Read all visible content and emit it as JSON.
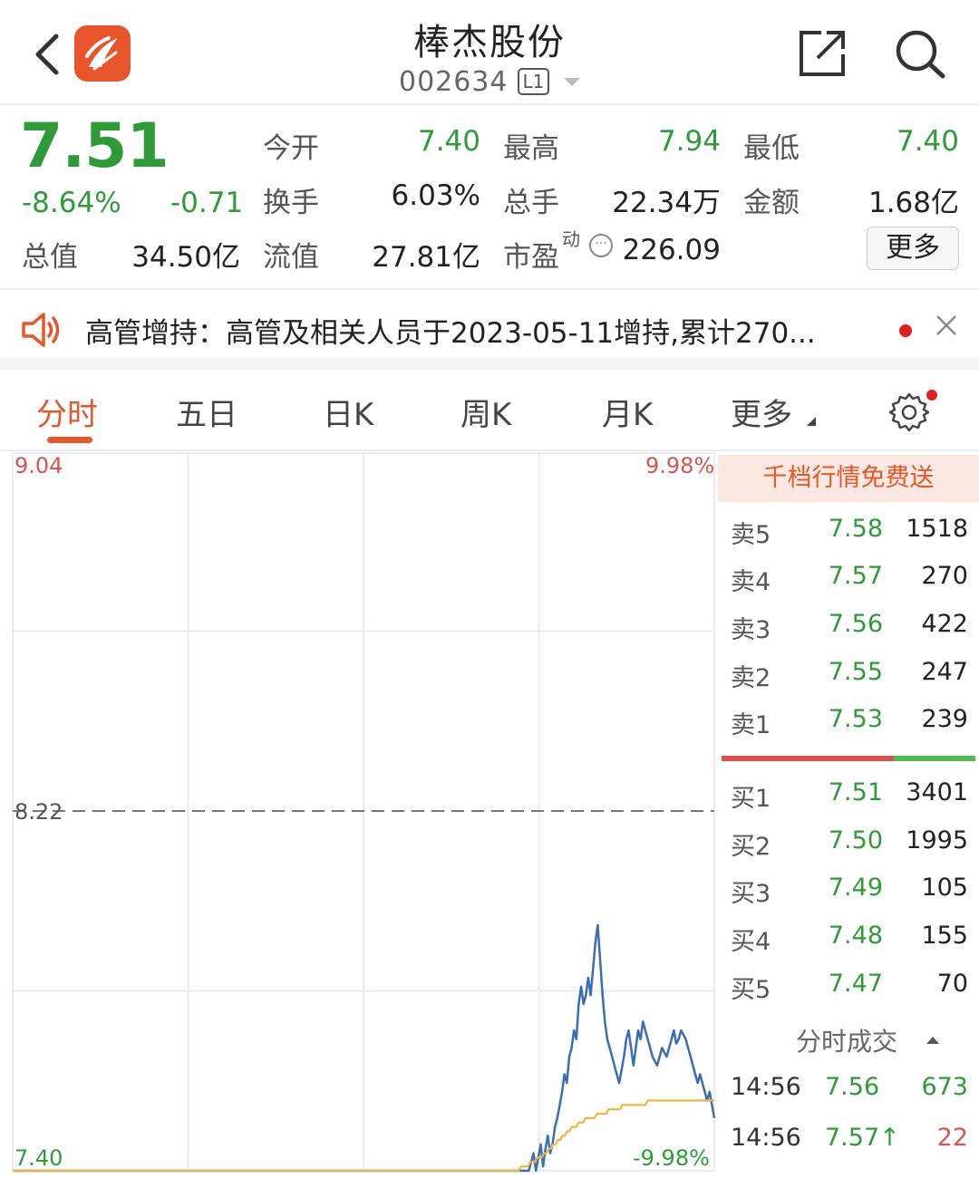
{
  "header": {
    "title": "棒杰股份",
    "code": "002634",
    "level": "L1"
  },
  "quote": {
    "price": "7.51",
    "change_pct": "-8.64%",
    "change": "-0.71",
    "stats": [
      {
        "label": "今开",
        "value": "7.40"
      },
      {
        "label": "最高",
        "value": "7.94"
      },
      {
        "label": "最低",
        "value": "7.40"
      },
      {
        "label": "换手",
        "value": "6.03%"
      },
      {
        "label": "总手",
        "value": "22.34万"
      },
      {
        "label": "金额",
        "value": "1.68亿"
      },
      {
        "label": "总值",
        "value": "34.50亿"
      },
      {
        "label": "流值",
        "value": "27.81亿"
      },
      {
        "label": "市盈",
        "value": "226.09"
      }
    ],
    "pe_superscript": "动",
    "more_label": "更多"
  },
  "notice": {
    "text": "高管增持：高管及相关人员于2023-05-11增持,累计270..."
  },
  "tabs": [
    "分时",
    "五日",
    "日K",
    "周K",
    "月K",
    "更多"
  ],
  "active_tab": "分时",
  "colors": {
    "accent": "#e8552b",
    "up": "#d9534f",
    "down": "#2f9b38",
    "price_line": "#3a6db5",
    "avg_line": "#f0b440"
  },
  "chart_data": {
    "type": "line",
    "y_axis_left": {
      "top": "9.04",
      "mid": "8.22",
      "bottom": "7.40"
    },
    "y_axis_right": {
      "top": "9.98%",
      "bottom": "-9.98%"
    },
    "ylim": [
      7.4,
      9.04
    ],
    "prev_close": 8.22,
    "grid": true,
    "series": [
      {
        "values": [
          7.4,
          7.4,
          7.4,
          7.4,
          7.4,
          7.4,
          7.4,
          7.4,
          7.4,
          7.4,
          7.4,
          7.4,
          7.4,
          7.4,
          7.4,
          7.4,
          7.4,
          7.4,
          7.4,
          7.4,
          7.4,
          7.4,
          7.4,
          7.4,
          7.4,
          7.4,
          7.4,
          7.4,
          7.4,
          7.4,
          7.4,
          7.4,
          7.4,
          7.4,
          7.4,
          7.4,
          7.4,
          7.4,
          7.4,
          7.4,
          7.4,
          7.4,
          7.4,
          7.4,
          7.4,
          7.4,
          7.4,
          7.4,
          7.4,
          7.4,
          7.4,
          7.4,
          7.4,
          7.4,
          7.4,
          7.4,
          7.4,
          7.4,
          7.4,
          7.4,
          7.4,
          7.4,
          7.4,
          7.4,
          7.4,
          7.4,
          7.4,
          7.4,
          7.4,
          7.4,
          7.4,
          7.4,
          7.4,
          7.4,
          7.4,
          7.4,
          7.4,
          7.4,
          7.4,
          7.4,
          7.4,
          7.4,
          7.4,
          7.4,
          7.4,
          7.4,
          7.4,
          7.4,
          7.4,
          7.4,
          7.4,
          7.4,
          7.4,
          7.4,
          7.4,
          7.4,
          7.4,
          7.4,
          7.4,
          7.4,
          7.4,
          7.4,
          7.4,
          7.4,
          7.4,
          7.4,
          7.4,
          7.4,
          7.4,
          7.4,
          7.4,
          7.4,
          7.4,
          7.4,
          7.4,
          7.4,
          7.4,
          7.4,
          7.4,
          7.4,
          7.4,
          7.4,
          7.4,
          7.4,
          7.4,
          7.4,
          7.4,
          7.4,
          7.4,
          7.4,
          7.4,
          7.4,
          7.4,
          7.4,
          7.4,
          7.4,
          7.4,
          7.4,
          7.4,
          7.4,
          7.4,
          7.4,
          7.4,
          7.4,
          7.4,
          7.4,
          7.4,
          7.4,
          7.4,
          7.4,
          7.4,
          7.4,
          7.4,
          7.4,
          7.4,
          7.4,
          7.4,
          7.4,
          7.4,
          7.4,
          7.4,
          7.4,
          7.4,
          7.4,
          7.4,
          7.4,
          7.4,
          7.4,
          7.4,
          7.4,
          7.4,
          7.4,
          7.4,
          7.4,
          7.4,
          7.4,
          7.4,
          7.4,
          7.4,
          7.4,
          7.4,
          7.4,
          7.4,
          7.4,
          7.4,
          7.4,
          7.4,
          7.4,
          7.4,
          7.4,
          7.4,
          7.4,
          7.4,
          7.4,
          7.4,
          7.4,
          7.4,
          7.4,
          7.4,
          7.4,
          7.4,
          7.4,
          7.4,
          7.4,
          7.4,
          7.4,
          7.4,
          7.4,
          7.4,
          7.4,
          7.4,
          7.4,
          7.4,
          7.4,
          7.4,
          7.4,
          7.4,
          7.4,
          7.42,
          7.44,
          7.4,
          7.43,
          7.46,
          7.41,
          7.45,
          7.48,
          7.44,
          7.46,
          7.5,
          7.52,
          7.55,
          7.58,
          7.62,
          7.6,
          7.66,
          7.68,
          7.72,
          7.7,
          7.78,
          7.82,
          7.78,
          7.8,
          7.84,
          7.8,
          7.86,
          7.92,
          7.96,
          7.88,
          7.8,
          7.74,
          7.7,
          7.68,
          7.66,
          7.64,
          7.62,
          7.6,
          7.63,
          7.66,
          7.7,
          7.72,
          7.68,
          7.64,
          7.68,
          7.72,
          7.7,
          7.74,
          7.72,
          7.7,
          7.68,
          7.66,
          7.65,
          7.64,
          7.66,
          7.68,
          7.67,
          7.66,
          7.68,
          7.7,
          7.72,
          7.69,
          7.7,
          7.72,
          7.71,
          7.7,
          7.68,
          7.66,
          7.64,
          7.62,
          7.6,
          7.62,
          7.6,
          7.58,
          7.56,
          7.58,
          7.55,
          7.52
        ],
        "color": "#3a6db5"
      },
      {
        "values": [
          7.4,
          7.4,
          7.4,
          7.4,
          7.4,
          7.4,
          7.4,
          7.4,
          7.4,
          7.4,
          7.4,
          7.4,
          7.4,
          7.4,
          7.4,
          7.4,
          7.4,
          7.4,
          7.4,
          7.4,
          7.4,
          7.4,
          7.4,
          7.4,
          7.4,
          7.4,
          7.4,
          7.4,
          7.4,
          7.4,
          7.4,
          7.4,
          7.4,
          7.4,
          7.4,
          7.4,
          7.4,
          7.4,
          7.4,
          7.4,
          7.4,
          7.4,
          7.4,
          7.4,
          7.4,
          7.4,
          7.4,
          7.4,
          7.4,
          7.4,
          7.4,
          7.4,
          7.4,
          7.4,
          7.4,
          7.4,
          7.4,
          7.4,
          7.4,
          7.4,
          7.4,
          7.4,
          7.4,
          7.4,
          7.4,
          7.4,
          7.4,
          7.4,
          7.4,
          7.4,
          7.4,
          7.4,
          7.4,
          7.4,
          7.4,
          7.4,
          7.4,
          7.4,
          7.4,
          7.4,
          7.4,
          7.4,
          7.4,
          7.4,
          7.4,
          7.4,
          7.4,
          7.4,
          7.4,
          7.4,
          7.4,
          7.4,
          7.4,
          7.4,
          7.4,
          7.4,
          7.4,
          7.4,
          7.4,
          7.4,
          7.4,
          7.4,
          7.4,
          7.4,
          7.4,
          7.4,
          7.4,
          7.4,
          7.4,
          7.4,
          7.4,
          7.4,
          7.4,
          7.4,
          7.4,
          7.4,
          7.4,
          7.4,
          7.4,
          7.4,
          7.4,
          7.4,
          7.4,
          7.4,
          7.4,
          7.4,
          7.4,
          7.4,
          7.4,
          7.4,
          7.4,
          7.4,
          7.4,
          7.4,
          7.4,
          7.4,
          7.4,
          7.4,
          7.4,
          7.4,
          7.4,
          7.4,
          7.4,
          7.4,
          7.4,
          7.4,
          7.4,
          7.4,
          7.4,
          7.4,
          7.4,
          7.4,
          7.4,
          7.4,
          7.4,
          7.4,
          7.4,
          7.4,
          7.4,
          7.4,
          7.4,
          7.4,
          7.4,
          7.4,
          7.4,
          7.4,
          7.4,
          7.4,
          7.4,
          7.4,
          7.4,
          7.4,
          7.4,
          7.4,
          7.4,
          7.4,
          7.4,
          7.4,
          7.4,
          7.4,
          7.4,
          7.4,
          7.4,
          7.4,
          7.4,
          7.4,
          7.4,
          7.4,
          7.4,
          7.4,
          7.4,
          7.4,
          7.4,
          7.4,
          7.4,
          7.4,
          7.4,
          7.4,
          7.4,
          7.4,
          7.4,
          7.4,
          7.4,
          7.4,
          7.4,
          7.4,
          7.4,
          7.4,
          7.4,
          7.4,
          7.4,
          7.4,
          7.4,
          7.4,
          7.4,
          7.4,
          7.4,
          7.4,
          7.4,
          7.4,
          7.4,
          7.41,
          7.41,
          7.41,
          7.41,
          7.42,
          7.42,
          7.42,
          7.43,
          7.43,
          7.43,
          7.44,
          7.44,
          7.45,
          7.45,
          7.46,
          7.46,
          7.47,
          7.47,
          7.48,
          7.48,
          7.49,
          7.49,
          7.5,
          7.5,
          7.5,
          7.51,
          7.51,
          7.51,
          7.52,
          7.52,
          7.52,
          7.52,
          7.52,
          7.53,
          7.53,
          7.53,
          7.53,
          7.53,
          7.54,
          7.54,
          7.54,
          7.54,
          7.54,
          7.54,
          7.55,
          7.55,
          7.55,
          7.55,
          7.55,
          7.55,
          7.55,
          7.55,
          7.55,
          7.55,
          7.55,
          7.56,
          7.56,
          7.56,
          7.56,
          7.56,
          7.56,
          7.56,
          7.56,
          7.56,
          7.56,
          7.56,
          7.56,
          7.56,
          7.56,
          7.56,
          7.56,
          7.56,
          7.56,
          7.56,
          7.56,
          7.56,
          7.56,
          7.56,
          7.56,
          7.56,
          7.56,
          7.56,
          7.56,
          7.56,
          7.56
        ],
        "color": "#f0b440"
      }
    ]
  },
  "order_book": {
    "promo": "千档行情免费送",
    "sells": [
      {
        "label": "卖5",
        "price": "7.58",
        "vol": "1518"
      },
      {
        "label": "卖4",
        "price": "7.57",
        "vol": "270"
      },
      {
        "label": "卖3",
        "price": "7.56",
        "vol": "422"
      },
      {
        "label": "卖2",
        "price": "7.55",
        "vol": "247"
      },
      {
        "label": "卖1",
        "price": "7.53",
        "vol": "239"
      }
    ],
    "buys": [
      {
        "label": "买1",
        "price": "7.51",
        "vol": "3401"
      },
      {
        "label": "买2",
        "price": "7.50",
        "vol": "1995"
      },
      {
        "label": "买3",
        "price": "7.49",
        "vol": "105"
      },
      {
        "label": "买4",
        "price": "7.48",
        "vol": "155"
      },
      {
        "label": "买5",
        "price": "7.47",
        "vol": "70"
      }
    ],
    "ticks_title": "分时成交",
    "ticks": [
      {
        "time": "14:56",
        "price": "7.56",
        "vol": "673",
        "vol_color": "#2f9b38"
      },
      {
        "time": "14:56",
        "price": "7.57↑",
        "vol": "22",
        "vol_color": "#d9534f"
      }
    ]
  }
}
